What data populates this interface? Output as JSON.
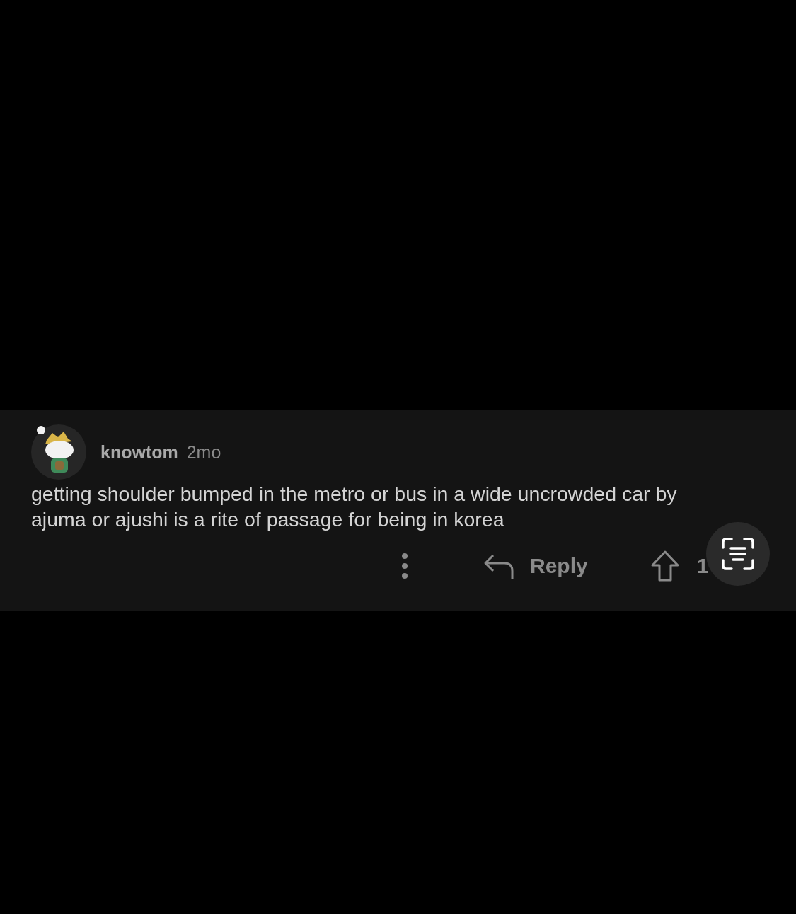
{
  "comment": {
    "author": "knowtom",
    "age": "2mo",
    "body": "getting shoulder bumped in the metro or bus in a wide uncrowded car by ajuma or ajushi is a rite of passage for being in korea",
    "reply_label": "Reply",
    "votes": "1"
  }
}
